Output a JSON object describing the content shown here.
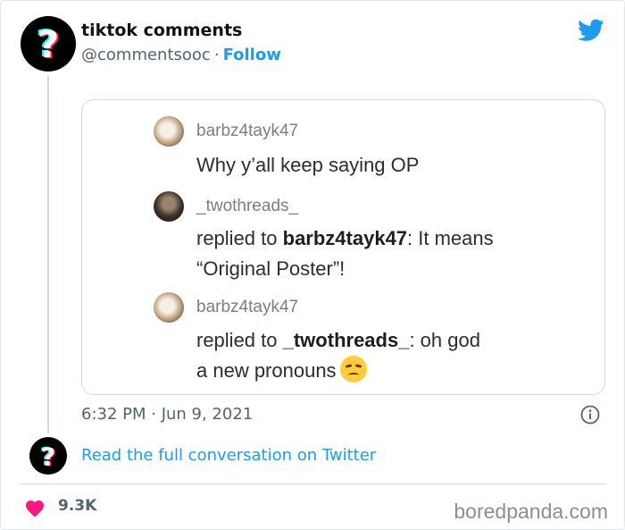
{
  "tweet": {
    "author_name": "tiktok comments",
    "author_handle": "@commentsooc",
    "separator": "·",
    "follow_label": "Follow",
    "timestamp": "6:32 PM · Jun 9, 2021",
    "read_full_label": "Read the full conversation on Twitter",
    "like_count": "9.3K"
  },
  "comments": [
    {
      "username": "barbz4tayk47",
      "text": "Why y’all keep saying OP"
    },
    {
      "username": "_twothreads_",
      "reply_prefix": "replied to ",
      "reply_target": "barbz4tayk47",
      "line1_rest": ": It means",
      "line2": "“Original Poster”!"
    },
    {
      "username": "barbz4tayk47",
      "reply_prefix": "replied to ",
      "reply_target": "_twothreads_",
      "line1_rest": ": oh god",
      "line2": "a new pronouns"
    }
  ],
  "watermark": "boredpanda.com",
  "icons": {
    "avatar": "tiktok-question-mark-icon",
    "brand": "twitter-bird-icon",
    "info": "info-icon",
    "like": "heart-icon",
    "emoji": "pouting-face-emoji"
  },
  "colors": {
    "accent": "#1d9bf0",
    "heart": "#f91880",
    "text_secondary": "#536471"
  }
}
